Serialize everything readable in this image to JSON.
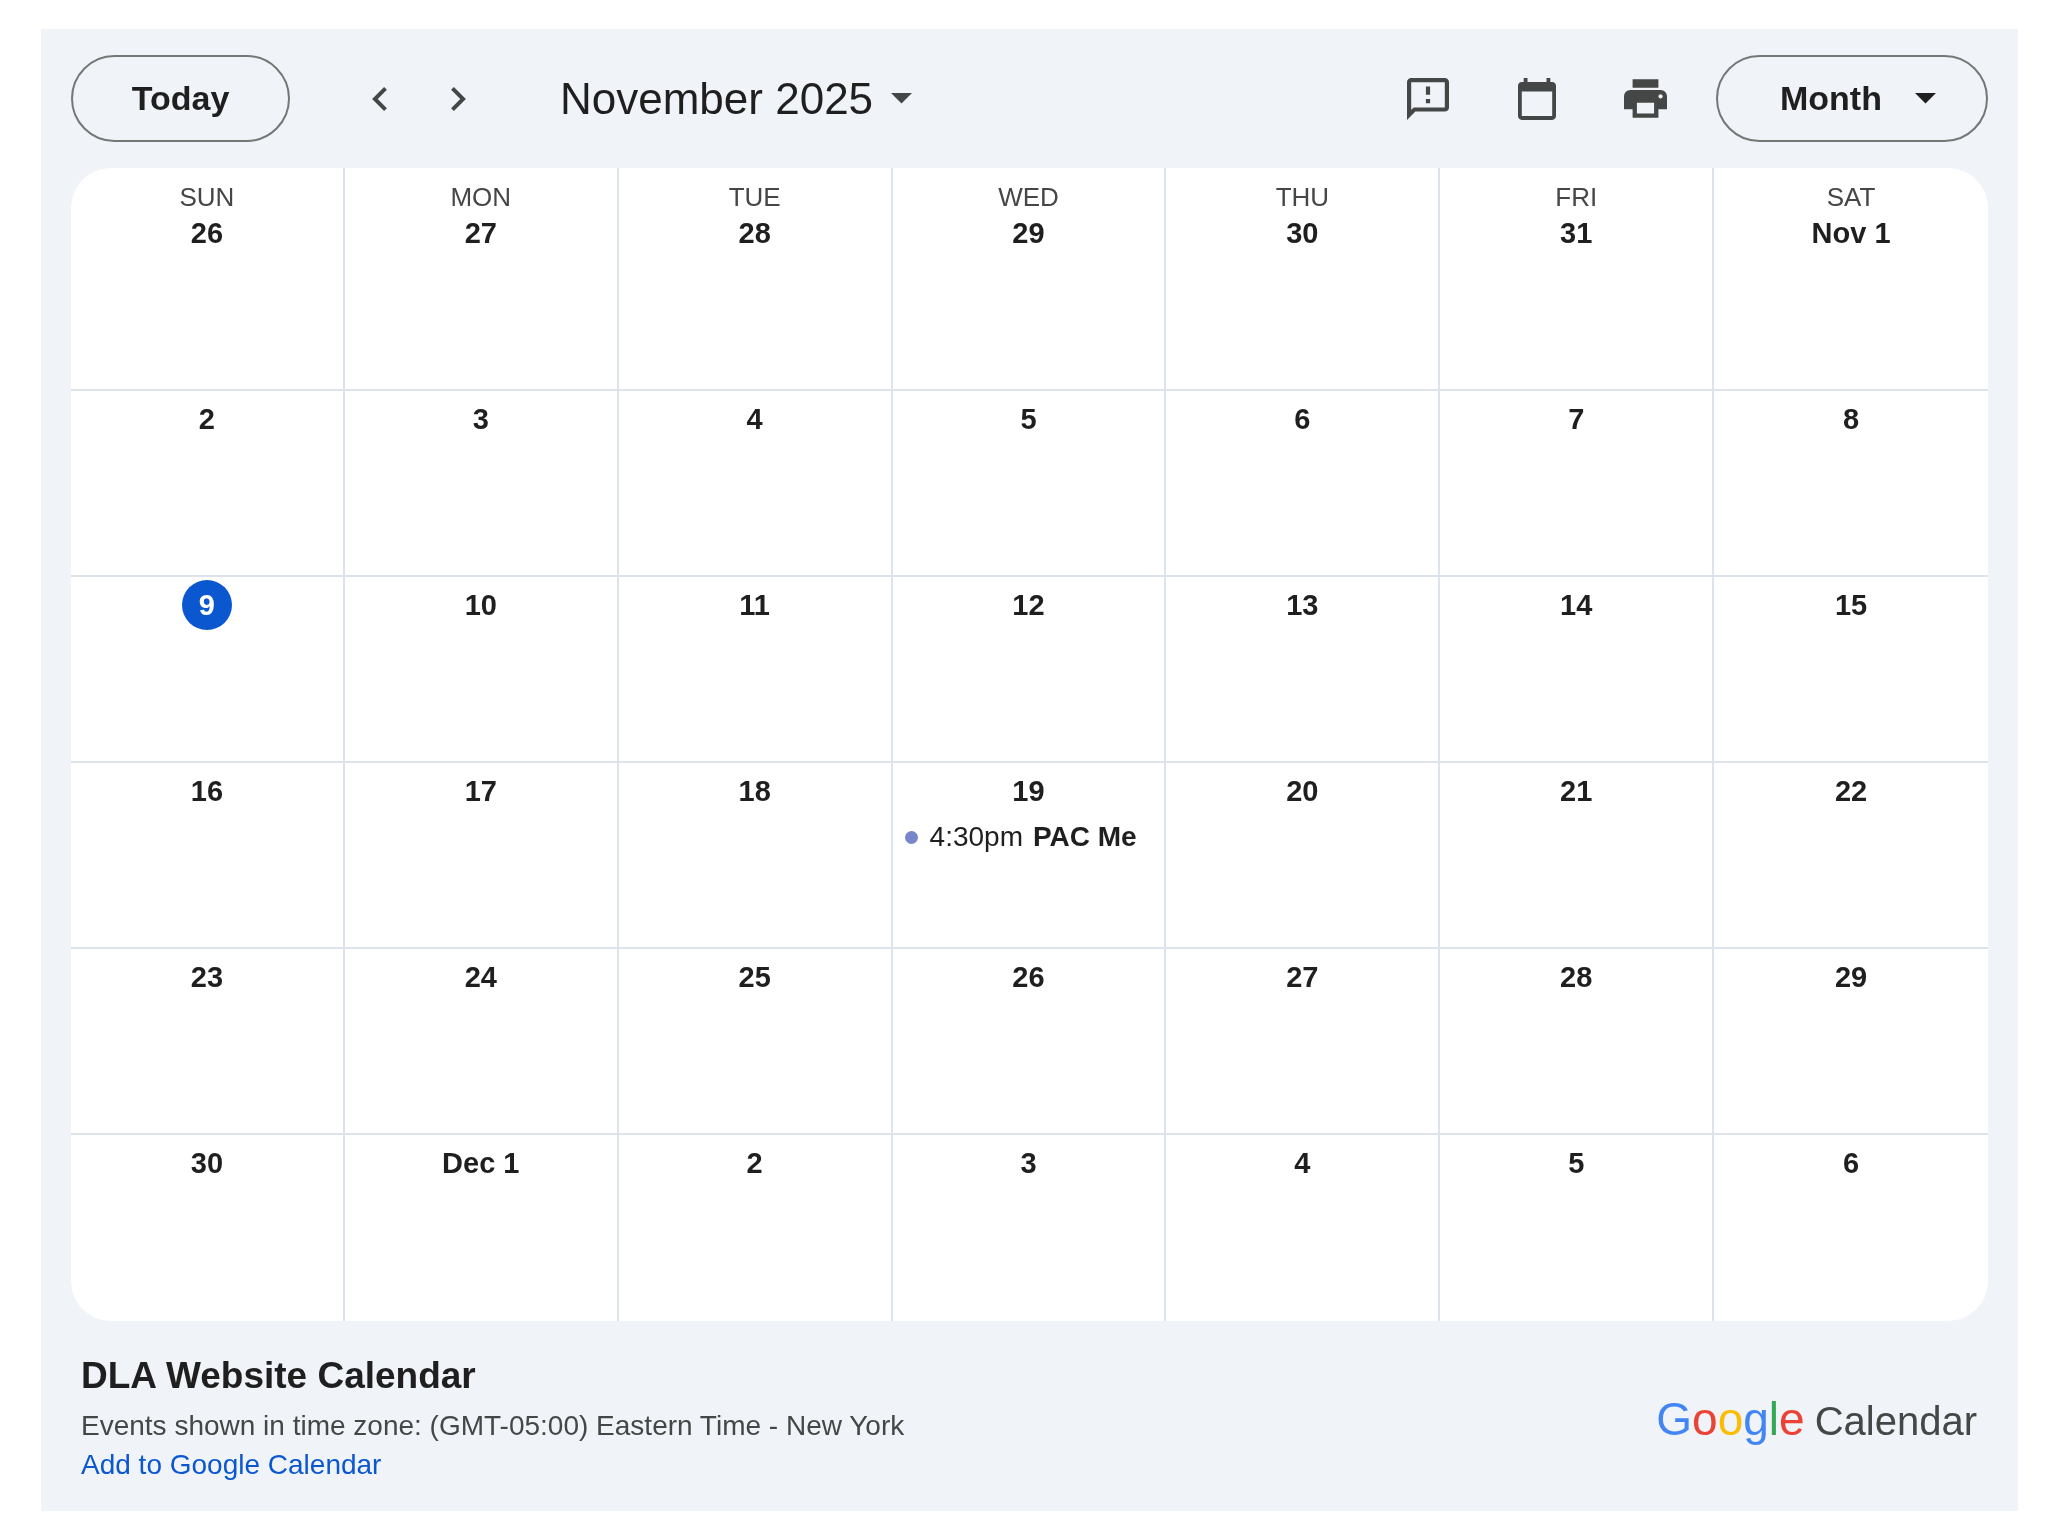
{
  "toolbar": {
    "today_button": "Today",
    "title": "November 2025",
    "view_button": "Month"
  },
  "weekdays": [
    "SUN",
    "MON",
    "TUE",
    "WED",
    "THU",
    "FRI",
    "SAT"
  ],
  "weeks": [
    [
      {
        "date": "26",
        "today": false
      },
      {
        "date": "27",
        "today": false
      },
      {
        "date": "28",
        "today": false
      },
      {
        "date": "29",
        "today": false
      },
      {
        "date": "30",
        "today": false
      },
      {
        "date": "31",
        "today": false
      },
      {
        "date": "Nov 1",
        "today": false
      }
    ],
    [
      {
        "date": "2",
        "today": false
      },
      {
        "date": "3",
        "today": false
      },
      {
        "date": "4",
        "today": false
      },
      {
        "date": "5",
        "today": false
      },
      {
        "date": "6",
        "today": false
      },
      {
        "date": "7",
        "today": false
      },
      {
        "date": "8",
        "today": false
      }
    ],
    [
      {
        "date": "9",
        "today": true
      },
      {
        "date": "10",
        "today": false
      },
      {
        "date": "11",
        "today": false
      },
      {
        "date": "12",
        "today": false
      },
      {
        "date": "13",
        "today": false
      },
      {
        "date": "14",
        "today": false
      },
      {
        "date": "15",
        "today": false
      }
    ],
    [
      {
        "date": "16",
        "today": false
      },
      {
        "date": "17",
        "today": false
      },
      {
        "date": "18",
        "today": false
      },
      {
        "date": "19",
        "today": false,
        "events": [
          {
            "time": "4:30pm",
            "title": "PAC Me",
            "color": "#7986cb"
          }
        ]
      },
      {
        "date": "20",
        "today": false
      },
      {
        "date": "21",
        "today": false
      },
      {
        "date": "22",
        "today": false
      }
    ],
    [
      {
        "date": "23",
        "today": false
      },
      {
        "date": "24",
        "today": false
      },
      {
        "date": "25",
        "today": false
      },
      {
        "date": "26",
        "today": false
      },
      {
        "date": "27",
        "today": false
      },
      {
        "date": "28",
        "today": false
      },
      {
        "date": "29",
        "today": false
      }
    ],
    [
      {
        "date": "30",
        "today": false
      },
      {
        "date": "Dec 1",
        "today": false
      },
      {
        "date": "2",
        "today": false
      },
      {
        "date": "3",
        "today": false
      },
      {
        "date": "4",
        "today": false
      },
      {
        "date": "5",
        "today": false
      },
      {
        "date": "6",
        "today": false
      }
    ]
  ],
  "footer": {
    "calendar_name": "DLA Website Calendar",
    "time_zone_note": "Events shown in time zone: (GMT-05:00) Eastern Time - New York",
    "link": "Add to Google Calendar",
    "logo": {
      "wordmark": "Google",
      "product": "Calendar"
    }
  }
}
